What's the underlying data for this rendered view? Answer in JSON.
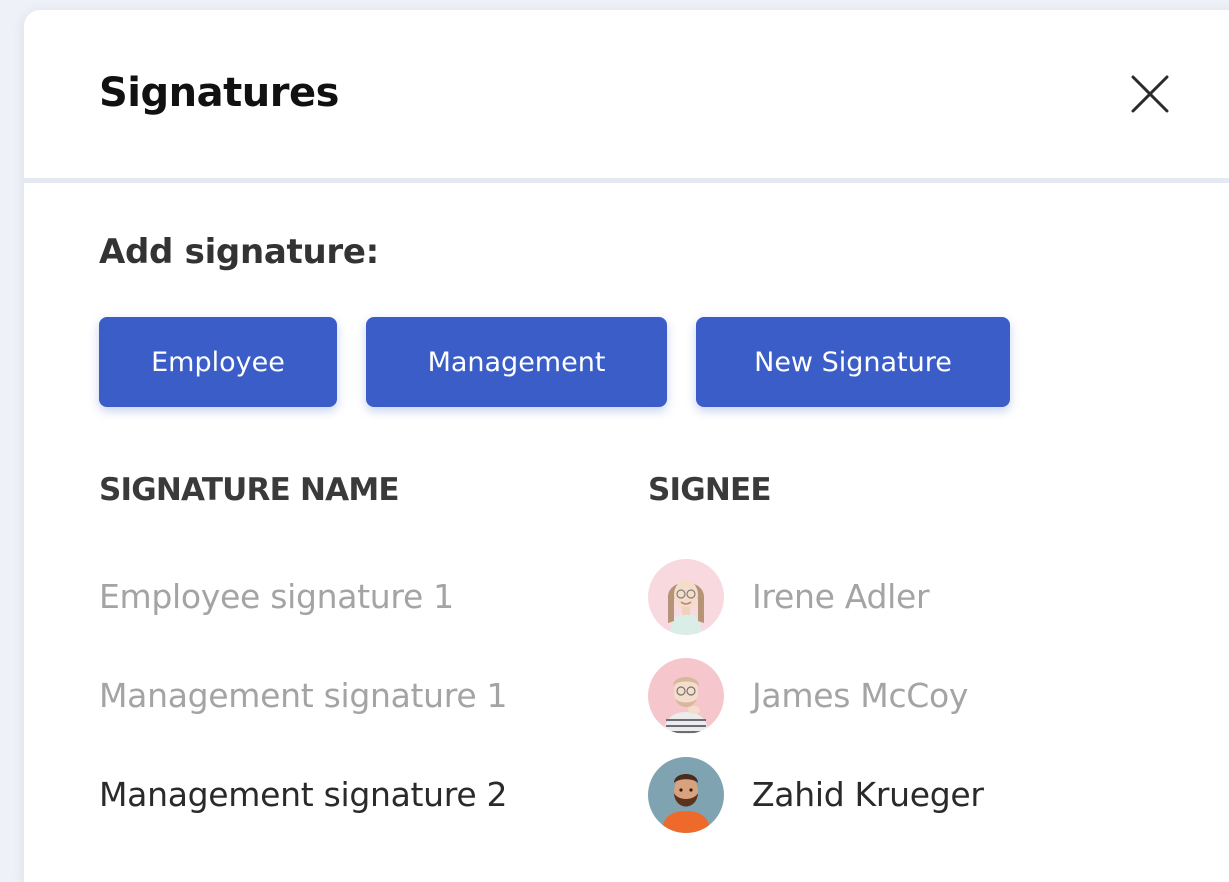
{
  "dialog": {
    "title": "Signatures",
    "close_icon": "close-icon"
  },
  "add_signature": {
    "label": "Add signature:",
    "buttons": [
      "Employee",
      "Management",
      "New Signature"
    ],
    "button_color": "#3a5dc8"
  },
  "table": {
    "columns": [
      "SIGNATURE NAME",
      "SIGNEE"
    ],
    "rows": [
      {
        "signature_name": "Employee signature 1",
        "signee": "Irene Adler",
        "avatar": "avatar-irene-adler",
        "state": "faded"
      },
      {
        "signature_name": "Management signature 1",
        "signee": "James McCoy",
        "avatar": "avatar-james-mccoy",
        "state": "faded"
      },
      {
        "signature_name": "Management signature 2",
        "signee": "Zahid Krueger",
        "avatar": "avatar-zahid-krueger",
        "state": "active"
      }
    ]
  }
}
